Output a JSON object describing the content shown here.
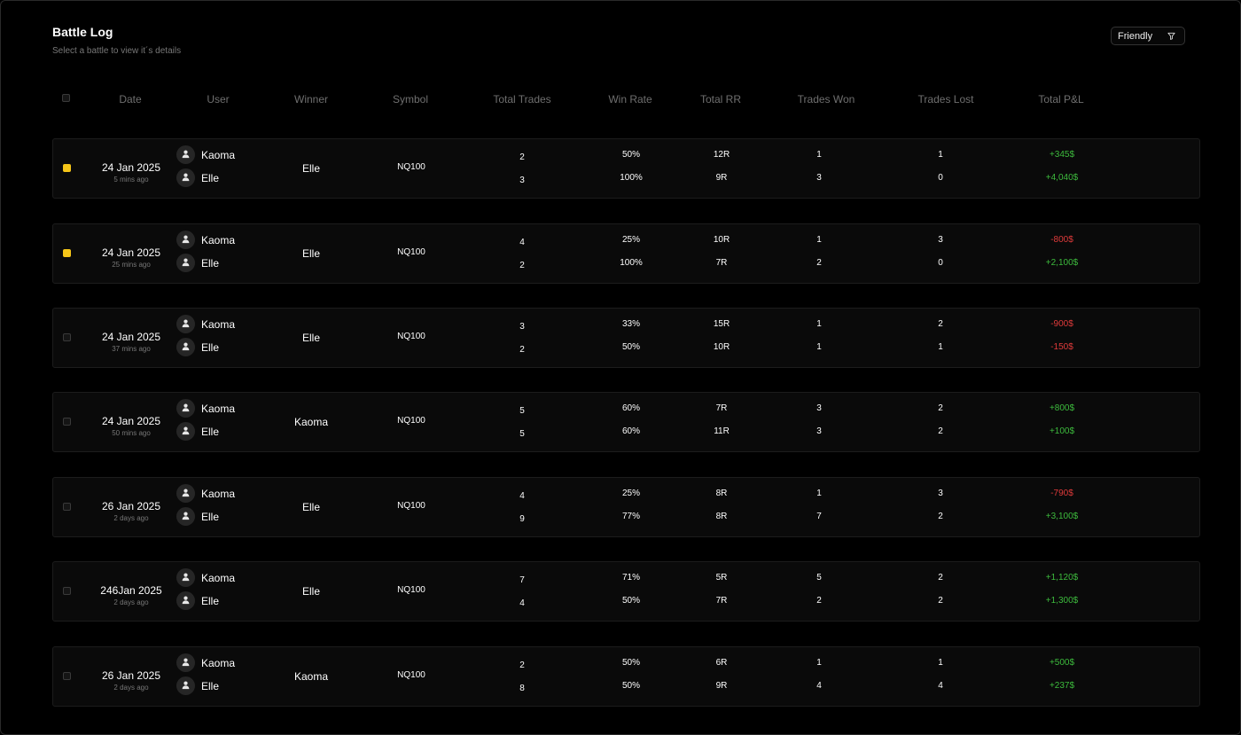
{
  "page": {
    "title": "Battle Log",
    "subtitle": "Select a battle to view it´s details",
    "filter_label": "Friendly",
    "filter_icon": "filter-icon"
  },
  "columns": [
    "Date",
    "User",
    "Winner",
    "Symbol",
    "Total Trades",
    "Win Rate",
    "Total RR",
    "Trades Won",
    "Trades Lost",
    "Total P&L"
  ],
  "colors": {
    "accent": "#f5c518",
    "positive": "#3dbb3d",
    "negative": "#e03b3b",
    "muted": "#6f6f6f"
  },
  "battles": [
    {
      "date": "24 Jan 2025",
      "ago": "5 mins ago",
      "checked": true,
      "winner": "Elle",
      "symbol": "NQ100",
      "players": [
        {
          "name": "Kaoma",
          "total_trades": "2",
          "win_rate": "50%",
          "total_rr": "12R",
          "won": "1",
          "lost": "1",
          "pnl": "+345$"
        },
        {
          "name": "Elle",
          "total_trades": "3",
          "win_rate": "100%",
          "total_rr": "9R",
          "won": "3",
          "lost": "0",
          "pnl": "+4,040$"
        }
      ]
    },
    {
      "date": "24 Jan 2025",
      "ago": "25 mins ago",
      "checked": true,
      "winner": "Elle",
      "symbol": "NQ100",
      "players": [
        {
          "name": "Kaoma",
          "total_trades": "4",
          "win_rate": "25%",
          "total_rr": "10R",
          "won": "1",
          "lost": "3",
          "pnl": "-800$"
        },
        {
          "name": "Elle",
          "total_trades": "2",
          "win_rate": "100%",
          "total_rr": "7R",
          "won": "2",
          "lost": "0",
          "pnl": "+2,100$"
        }
      ]
    },
    {
      "date": "24 Jan 2025",
      "ago": "37 mins ago",
      "checked": false,
      "winner": "Elle",
      "symbol": "NQ100",
      "players": [
        {
          "name": "Kaoma",
          "total_trades": "3",
          "win_rate": "33%",
          "total_rr": "15R",
          "won": "1",
          "lost": "2",
          "pnl": "-900$"
        },
        {
          "name": "Elle",
          "total_trades": "2",
          "win_rate": "50%",
          "total_rr": "10R",
          "won": "1",
          "lost": "1",
          "pnl": "-150$"
        }
      ]
    },
    {
      "date": "24 Jan 2025",
      "ago": "50 mins ago",
      "checked": false,
      "winner": "Kaoma",
      "symbol": "NQ100",
      "players": [
        {
          "name": "Kaoma",
          "total_trades": "5",
          "win_rate": "60%",
          "total_rr": "7R",
          "won": "3",
          "lost": "2",
          "pnl": "+800$"
        },
        {
          "name": "Elle",
          "total_trades": "5",
          "win_rate": "60%",
          "total_rr": "11R",
          "won": "3",
          "lost": "2",
          "pnl": "+100$"
        }
      ]
    },
    {
      "date": "26 Jan 2025",
      "ago": "2 days ago",
      "checked": false,
      "winner": "Elle",
      "symbol": "NQ100",
      "players": [
        {
          "name": "Kaoma",
          "total_trades": "4",
          "win_rate": "25%",
          "total_rr": "8R",
          "won": "1",
          "lost": "3",
          "pnl": "-790$"
        },
        {
          "name": "Elle",
          "total_trades": "9",
          "win_rate": "77%",
          "total_rr": "8R",
          "won": "7",
          "lost": "2",
          "pnl": "+3,100$"
        }
      ]
    },
    {
      "date": "246Jan 2025",
      "ago": "2 days ago",
      "checked": false,
      "winner": "Elle",
      "symbol": "NQ100",
      "players": [
        {
          "name": "Kaoma",
          "total_trades": "7",
          "win_rate": "71%",
          "total_rr": "5R",
          "won": "5",
          "lost": "2",
          "pnl": "+1,120$"
        },
        {
          "name": "Elle",
          "total_trades": "4",
          "win_rate": "50%",
          "total_rr": "7R",
          "won": "2",
          "lost": "2",
          "pnl": "+1,300$"
        }
      ]
    },
    {
      "date": "26 Jan 2025",
      "ago": "2 days ago",
      "checked": false,
      "winner": "Kaoma",
      "symbol": "NQ100",
      "players": [
        {
          "name": "Kaoma",
          "total_trades": "2",
          "win_rate": "50%",
          "total_rr": "6R",
          "won": "1",
          "lost": "1",
          "pnl": "+500$"
        },
        {
          "name": "Elle",
          "total_trades": "8",
          "win_rate": "50%",
          "total_rr": "9R",
          "won": "4",
          "lost": "4",
          "pnl": "+237$"
        }
      ]
    }
  ]
}
